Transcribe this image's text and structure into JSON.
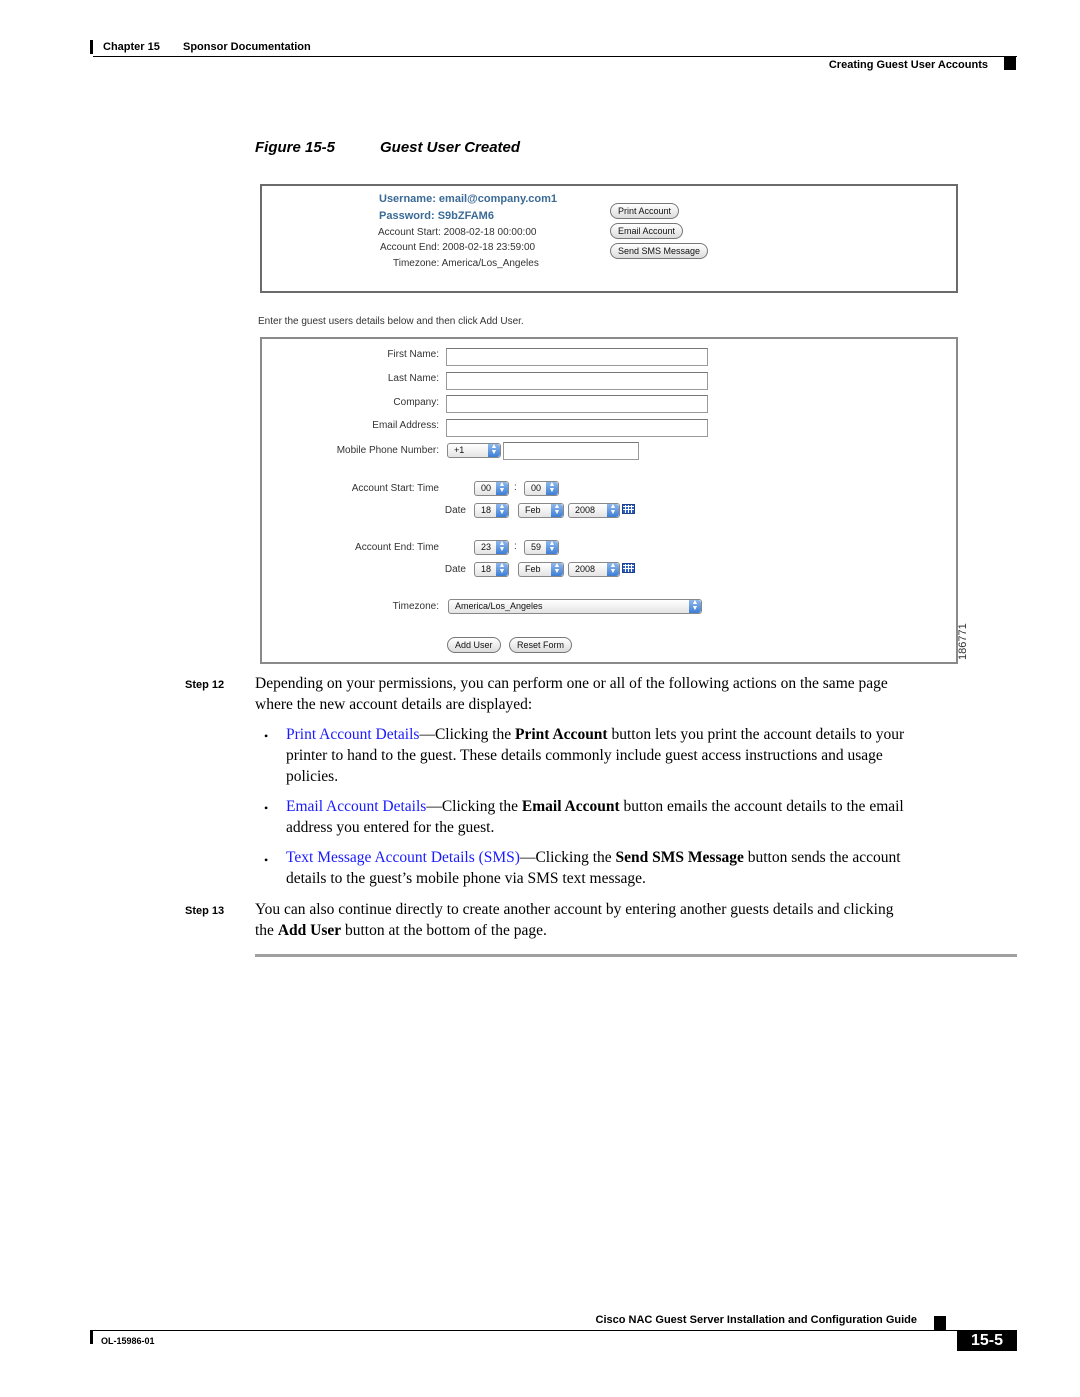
{
  "header": {
    "chapter": "Chapter 15",
    "chapter_title": "Sponsor Documentation",
    "section": "Creating Guest User Accounts"
  },
  "figure": {
    "number": "Figure 15-5",
    "title": "Guest User Created",
    "id": "186771"
  },
  "account_info": {
    "username_label": "Username:",
    "username": "email@company.com1",
    "password_label": "Password:",
    "password": "S9bZFAM6",
    "start_label": "Account Start:",
    "start": "2008-02-18 00:00:00",
    "end_label": "Account End:",
    "end": "2008-02-18 23:59:00",
    "timezone_label": "Timezone:",
    "timezone": "America/Los_Angeles",
    "buttons": {
      "print": "Print Account",
      "email": "Email Account",
      "sms": "Send SMS Message"
    }
  },
  "form": {
    "note": "Enter the guest users details below and then click Add User.",
    "fields": {
      "first_name": {
        "label": "First Name:",
        "value": ""
      },
      "last_name": {
        "label": "Last Name:",
        "value": ""
      },
      "company": {
        "label": "Company:",
        "value": ""
      },
      "email": {
        "label": "Email Address:",
        "value": ""
      },
      "mobile": {
        "label": "Mobile Phone Number:",
        "country_code": "+1",
        "value": ""
      }
    },
    "account_start": {
      "label": "Account Start:",
      "time_label": "Time",
      "hour": "00",
      "minute": "00",
      "date_label": "Date",
      "day": "18",
      "month": "Feb",
      "year": "2008"
    },
    "account_end": {
      "label": "Account End:",
      "time_label": "Time",
      "hour": "23",
      "minute": "59",
      "date_label": "Date",
      "day": "18",
      "month": "Feb",
      "year": "2008"
    },
    "time_separator": ":",
    "timezone_label": "Timezone:",
    "timezone": "America/Los_Angeles",
    "buttons": {
      "add_user": "Add User",
      "reset": "Reset Form"
    }
  },
  "body": {
    "step12_label": "Step 12",
    "step12_text_1": "Depending on your permissions, you can perform one or all of the following actions on the same page",
    "step12_text_2": "where the new account details are displayed:",
    "bullet_char": "•",
    "bullets": [
      {
        "link": "Print Account Details",
        "pre": "—Clicking the ",
        "bold": "Print Account",
        "post_1": " button lets you print the account details to your",
        "line2": "printer to hand to the guest. These details commonly include guest access instructions and usage",
        "line3": "policies."
      },
      {
        "link": "Email Account Details",
        "pre": "—Clicking the ",
        "bold": "Email Account",
        "post_1": " button emails the account details to the email",
        "line2": "address you entered for the guest."
      },
      {
        "link": "Text Message Account Details (SMS)",
        "pre": "—Clicking the ",
        "bold": "Send SMS Message",
        "post_1": " button sends the account",
        "line2": "details to the guest’s mobile phone via SMS text message."
      }
    ],
    "step13_label": "Step 13",
    "step13_text_1": "You can also continue directly to create another account by entering another guests details and clicking",
    "step13_pre": "the ",
    "step13_bold": "Add User",
    "step13_post": " button at the bottom of the page."
  },
  "footer": {
    "guide_title": "Cisco NAC Guest Server Installation and Configuration Guide",
    "doc_number": "OL-15986-01",
    "page_number": "15-5"
  }
}
